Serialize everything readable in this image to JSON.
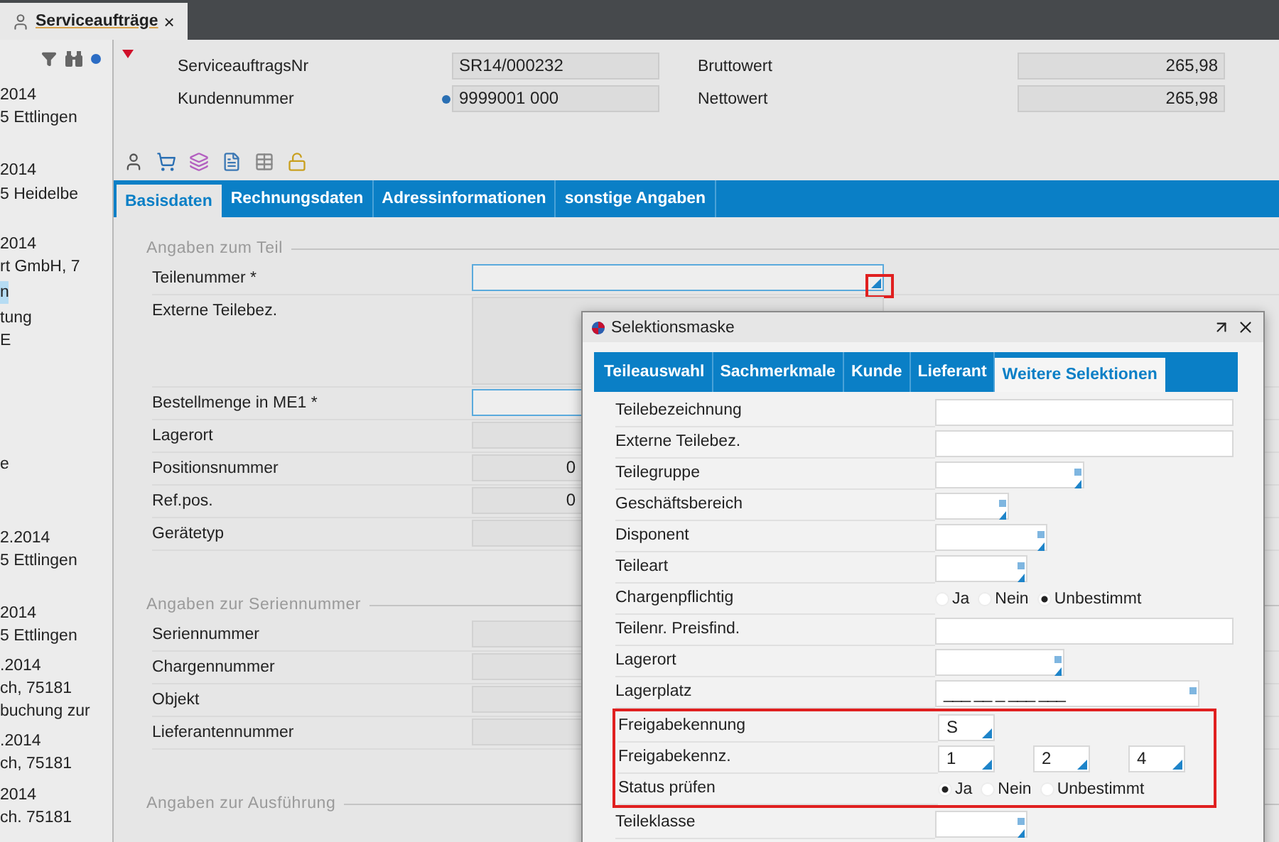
{
  "doc_tab": {
    "title": "Serviceaufträge",
    "close": "×"
  },
  "sidebar": {
    "lines": [
      {
        "text": "2014",
        "selected": false
      },
      {
        "text": "5 Ettlingen",
        "selected": false
      },
      {
        "text": "2014",
        "selected": false
      },
      {
        "text": "5 Heidelbe",
        "selected": false
      },
      {
        "text": "2014",
        "selected": false
      },
      {
        "text": "rt GmbH, 7",
        "selected": false
      },
      {
        "text": "n",
        "selected": true
      },
      {
        "text": "tung",
        "selected": false
      },
      {
        "text": "E",
        "selected": false
      },
      {
        "text": "e",
        "selected": false
      },
      {
        "text": "2.2014",
        "selected": false
      },
      {
        "text": "5 Ettlingen",
        "selected": false
      },
      {
        "text": "2014",
        "selected": false
      },
      {
        "text": "5 Ettlingen",
        "selected": false
      },
      {
        "text": ".2014",
        "selected": false
      },
      {
        "text": "ch, 75181",
        "selected": false
      },
      {
        "text": "buchung zur",
        "selected": false
      },
      {
        "text": ".2014",
        "selected": false
      },
      {
        "text": "ch, 75181",
        "selected": false
      },
      {
        "text": "2014",
        "selected": false
      },
      {
        "text": "ch. 75181",
        "selected": false
      }
    ]
  },
  "header": {
    "rows": [
      {
        "label": "ServiceauftragsNr",
        "value": "SR14/000232",
        "info": false,
        "label2": "Bruttowert",
        "value2": "265,98"
      },
      {
        "label": "Kundennummer",
        "value": "9999001 000",
        "info": true,
        "label2": "Nettowert",
        "value2": "265,98"
      }
    ]
  },
  "tabs": [
    {
      "label": "Basisdaten",
      "selected": true
    },
    {
      "label": "Rechnungsdaten",
      "selected": false
    },
    {
      "label": "Adressinformationen",
      "selected": false
    },
    {
      "label": "sonstige Angaben",
      "selected": false
    }
  ],
  "sections": [
    {
      "title": "Angaben zum Teil",
      "fields": [
        {
          "label": "Teilenummer *",
          "kind": "input",
          "focused": true,
          "marked": true
        },
        {
          "label": "Externe Teilebez.",
          "kind": "area",
          "focused": false,
          "marked": false
        },
        {
          "label": "Bestellmenge in ME1 *",
          "kind": "input",
          "focused": true,
          "marked": false
        },
        {
          "label": "Lagerort",
          "kind": "input",
          "focused": false,
          "marked": false
        },
        {
          "label": "Positionsnummer",
          "kind": "input",
          "focused": false,
          "marked": false,
          "value": "0"
        },
        {
          "label": "Ref.pos.",
          "kind": "input",
          "focused": false,
          "marked": false,
          "value": "0"
        },
        {
          "label": "Gerätetyp",
          "kind": "input",
          "focused": false,
          "marked": false
        }
      ]
    },
    {
      "title": "Angaben zur Seriennummer",
      "fields": [
        {
          "label": "Seriennummer",
          "kind": "input",
          "focused": false,
          "marked": false
        },
        {
          "label": "Chargennummer",
          "kind": "input",
          "focused": false,
          "marked": false
        },
        {
          "label": "Objekt",
          "kind": "input",
          "focused": false,
          "marked": false
        },
        {
          "label": "Lieferantennummer",
          "kind": "input",
          "focused": false,
          "marked": false
        }
      ]
    },
    {
      "title": "Angaben zur Ausführung"
    }
  ],
  "dialog": {
    "title": "Selektionsmaske",
    "tabs": [
      {
        "label": "Teileauswahl",
        "selected": false
      },
      {
        "label": "Sachmerkmale",
        "selected": false
      },
      {
        "label": "Kunde",
        "selected": false
      },
      {
        "label": "Lieferant",
        "selected": false
      },
      {
        "label": "Weitere Selektionen",
        "selected": true
      }
    ],
    "rows": [
      {
        "label": "Teilebezeichnung",
        "kind": "text",
        "highlighted": false
      },
      {
        "label": "Externe Teilebez.",
        "kind": "text",
        "highlighted": false
      },
      {
        "label": "Teilegruppe",
        "kind": "lookup",
        "highlighted": false
      },
      {
        "label": "Geschäftsbereich",
        "kind": "lookup",
        "highlighted": false
      },
      {
        "label": "Disponent",
        "kind": "lookup",
        "highlighted": false
      },
      {
        "label": "Teileart",
        "kind": "lookup",
        "highlighted": false
      },
      {
        "label": "Chargenpflichtig",
        "kind": "radio",
        "highlighted": false,
        "options": [
          {
            "label": "Ja",
            "selected": false
          },
          {
            "label": "Nein",
            "selected": false
          },
          {
            "label": "Unbestimmt",
            "selected": true
          }
        ]
      },
      {
        "label": "Teilenr. Preisfind.",
        "kind": "text",
        "highlighted": false
      },
      {
        "label": "Lagerort",
        "kind": "lookup",
        "highlighted": false
      },
      {
        "label": "Lagerplatz",
        "kind": "mask",
        "highlighted": false,
        "value": "___ __ _ ___ ___"
      },
      {
        "label": "Freigabekennung",
        "kind": "codes",
        "highlighted": true,
        "values": [
          "S"
        ]
      },
      {
        "label": "Freigabekennz.",
        "kind": "codes",
        "highlighted": true,
        "values": [
          "1",
          "2",
          "4"
        ]
      },
      {
        "label": "Status prüfen",
        "kind": "radio",
        "highlighted": true,
        "options": [
          {
            "label": "Ja",
            "selected": true
          },
          {
            "label": "Nein",
            "selected": false
          },
          {
            "label": "Unbestimmt",
            "selected": false
          }
        ]
      },
      {
        "label": "Teileklasse",
        "kind": "lookup",
        "highlighted": false
      }
    ]
  }
}
